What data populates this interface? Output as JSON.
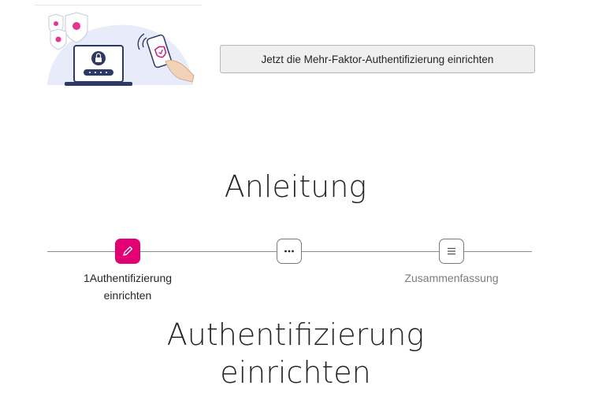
{
  "setup_button": {
    "label": "Jetzt die Mehr-Faktor-Authentifizierung einrichten"
  },
  "guide": {
    "title": "Anleitung"
  },
  "stepper": {
    "steps": [
      {
        "number": "1",
        "label_line1": "Authentifizierung",
        "label_line2": "einrichten",
        "icon": "pencil-icon",
        "state": "active"
      },
      {
        "label": "",
        "icon": "ellipsis-icon",
        "state": "pending"
      },
      {
        "label": "Zusammenfassung",
        "icon": "list-icon",
        "state": "pending"
      }
    ]
  },
  "current_step": {
    "heading_line1": "Authentifizierung",
    "heading_line2": "einrichten"
  },
  "colors": {
    "accent": "#e20074",
    "illustration_bg": "#e8ecfa",
    "text": "#262626"
  }
}
